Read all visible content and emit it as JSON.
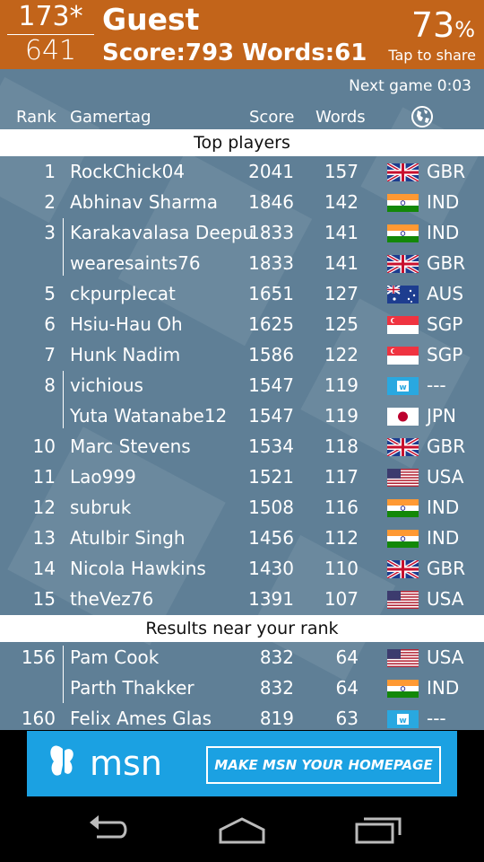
{
  "header": {
    "rank": "173*",
    "total_players": "641",
    "player_name": "Guest",
    "stats": "Score:793 Words:61",
    "percentile_value": "73",
    "percentile_unit": "%",
    "share_text": "Tap to share"
  },
  "board": {
    "next_game": "Next game 0:03",
    "columns": {
      "rank": "Rank",
      "gamertag": "Gamertag",
      "score": "Score",
      "words": "Words",
      "country_icon": "globe-icon"
    },
    "top_section_label": "Top players",
    "top_players": [
      {
        "rank": "1",
        "gamertag": "RockChick04",
        "score": "2041",
        "words": "157",
        "flag": "gbr",
        "country": "GBR"
      },
      {
        "rank": "2",
        "gamertag": "Abhinav Sharma",
        "score": "1846",
        "words": "142",
        "flag": "ind",
        "country": "IND"
      },
      {
        "rank": "3",
        "gamertag": "Karakavalasa Deepu",
        "score": "1833",
        "words": "141",
        "flag": "ind",
        "country": "IND"
      },
      {
        "rank": "",
        "gamertag": "wearesaints76",
        "score": "1833",
        "words": "141",
        "flag": "gbr",
        "country": "GBR"
      },
      {
        "rank": "5",
        "gamertag": "ckpurplecat",
        "score": "1651",
        "words": "127",
        "flag": "aus",
        "country": "AUS"
      },
      {
        "rank": "6",
        "gamertag": "Hsiu-Hau Oh",
        "score": "1625",
        "words": "125",
        "flag": "sgp",
        "country": "SGP"
      },
      {
        "rank": "7",
        "gamertag": "Hunk Nadim",
        "score": "1586",
        "words": "122",
        "flag": "sgp",
        "country": "SGP"
      },
      {
        "rank": "8",
        "gamertag": "vichious",
        "score": "1547",
        "words": "119",
        "flag": "unknown",
        "country": "---"
      },
      {
        "rank": "",
        "gamertag": "Yuta Watanabe12",
        "score": "1547",
        "words": "119",
        "flag": "jpn",
        "country": "JPN"
      },
      {
        "rank": "10",
        "gamertag": "Marc Stevens",
        "score": "1534",
        "words": "118",
        "flag": "gbr",
        "country": "GBR"
      },
      {
        "rank": "11",
        "gamertag": "Lao999",
        "score": "1521",
        "words": "117",
        "flag": "usa",
        "country": "USA"
      },
      {
        "rank": "12",
        "gamertag": "subruk",
        "score": "1508",
        "words": "116",
        "flag": "ind",
        "country": "IND"
      },
      {
        "rank": "13",
        "gamertag": "Atulbir Singh",
        "score": "1456",
        "words": "112",
        "flag": "ind",
        "country": "IND"
      },
      {
        "rank": "14",
        "gamertag": "Nicola Hawkins",
        "score": "1430",
        "words": "110",
        "flag": "gbr",
        "country": "GBR"
      },
      {
        "rank": "15",
        "gamertag": "theVez76",
        "score": "1391",
        "words": "107",
        "flag": "usa",
        "country": "USA"
      }
    ],
    "near_section_label": "Results near your rank",
    "near_players": [
      {
        "rank": "156",
        "gamertag": "Pam Cook",
        "score": "832",
        "words": "64",
        "flag": "usa",
        "country": "USA"
      },
      {
        "rank": "",
        "gamertag": "Parth Thakker",
        "score": "832",
        "words": "64",
        "flag": "ind",
        "country": "IND"
      },
      {
        "rank": "160",
        "gamertag": "Felix Ames Glas",
        "score": "819",
        "words": "63",
        "flag": "unknown",
        "country": "---"
      }
    ]
  },
  "ad": {
    "brand": "msn",
    "cta": "MAKE MSN YOUR HOMEPAGE",
    "logo_icon": "msn-butterfly-icon"
  },
  "navbar": {
    "back_icon": "back-icon",
    "home_icon": "home-icon",
    "recent_icon": "recent-apps-icon"
  },
  "colors": {
    "header_bg": "#c2641a",
    "board_bg": "#5f7f96",
    "ad_bg": "#1ba1e2"
  }
}
